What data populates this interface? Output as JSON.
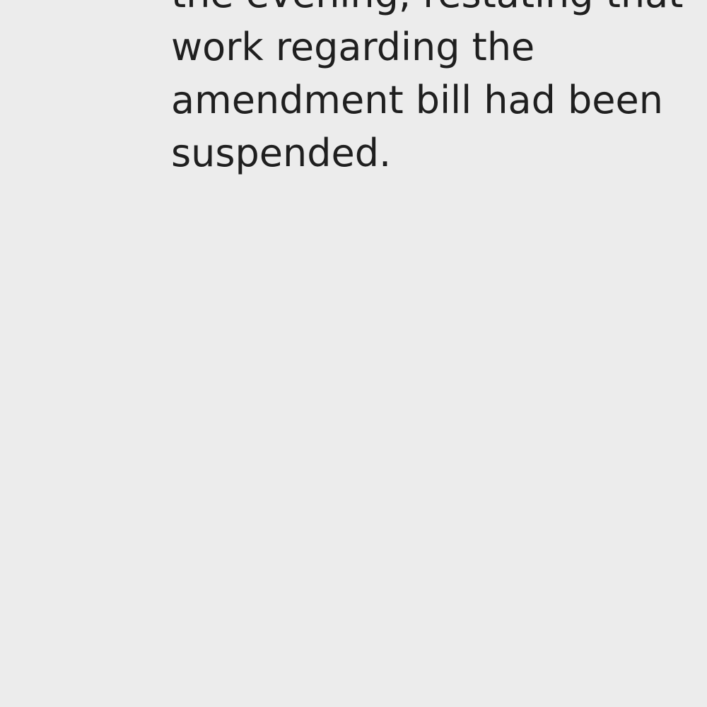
{
  "article": {
    "lines": [
      "the evening, restating that",
      "work regarding the",
      "amendment bill had been",
      "suspended."
    ]
  },
  "colors": {
    "background": "#ececec",
    "text": "#1f1f1f"
  }
}
